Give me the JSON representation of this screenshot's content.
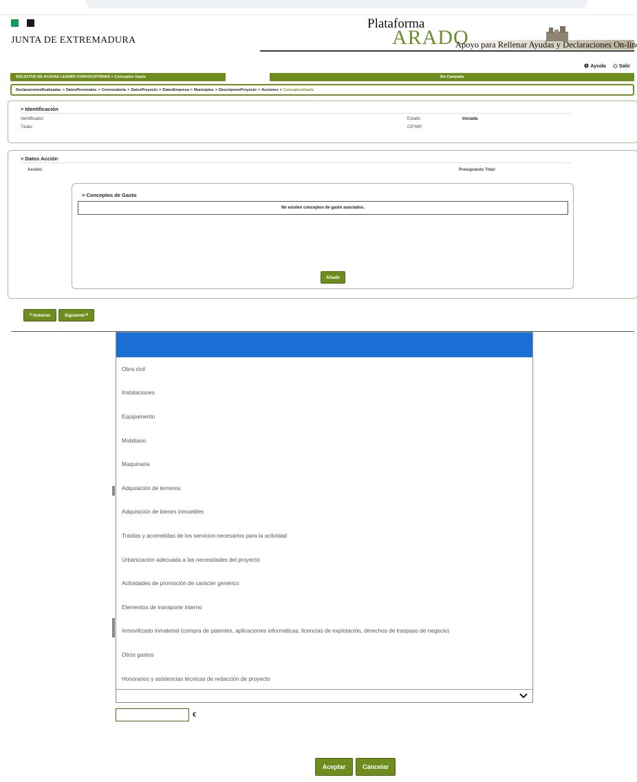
{
  "header": {
    "org_name": "JUNTA DE EXTREMADURA",
    "platform_line1": "Plataforma",
    "platform_line2": "ARADO",
    "platform_tagline": "Apoyo para Rellenar Ayudas y Declaraciones On-line",
    "help_label": "Ayuda",
    "logout_label": "Salir",
    "colors": {
      "brand_green": "#6f8d1f",
      "square_green": "#139b5a",
      "dropdown_blue": "#1a6fd4"
    }
  },
  "bars": {
    "left_title": "SOLICITUD DE AYUDAS LEADER CONVOCATORIAS > Conceptos Gasto",
    "right_title": "Sin Campaña"
  },
  "breadcrumb": {
    "items": [
      "DeclaracionesRealizadas",
      "DatosPersonales",
      "Convocatoria",
      "DatosProyecto",
      "DatosEmpresa",
      "Municipios",
      "DescripcionProyecto",
      "Acciones"
    ],
    "active": "ConceptosGasto",
    "separator": ">"
  },
  "identificacion": {
    "title": "Identificación",
    "identificador_label": "Identificador:",
    "titular_label": "Titular:",
    "estado_label": "Estado:",
    "estado_value": "Iniciada",
    "cif_label": "CIF/NIF:"
  },
  "datos_accion": {
    "title": "Datos Acción",
    "accion_label": "Acción:",
    "presupuesto_label": "Presupuesto Total:"
  },
  "conceptos": {
    "title": "Conceptos de Gasto",
    "empty_message": "No existen conceptos de gasto asociados.",
    "add_button": "Añadir"
  },
  "nav": {
    "prev_button": "Anterior",
    "next_button": "Siguiente"
  },
  "modal": {
    "options": [
      "Obra civil",
      "Instalaciones",
      "Equipamento",
      "Mobiliario",
      "Maquinaria",
      "Adquisición de terrenos",
      "Adquisición de bienes inmuebles",
      "Traídas y acometidas de los servicios necesarios para la actividad",
      "Urbanización adecuada a las necesidades del proyecto",
      "Actividades de promoción de carácter genérico",
      "Elementos de transporte interno",
      "Inmovilizado inmaterial (compra de patentes, aplicaciones informáticas, licencias de explotación, derechos de traspaso de negocio)",
      "Otros gastos",
      "Honorarios y asistencias técnicas de redacción de proyecto"
    ],
    "select_value": "",
    "amount_value": "",
    "currency_symbol": "€",
    "accept_button": "Aceptar",
    "cancel_button": "Cancelar"
  }
}
